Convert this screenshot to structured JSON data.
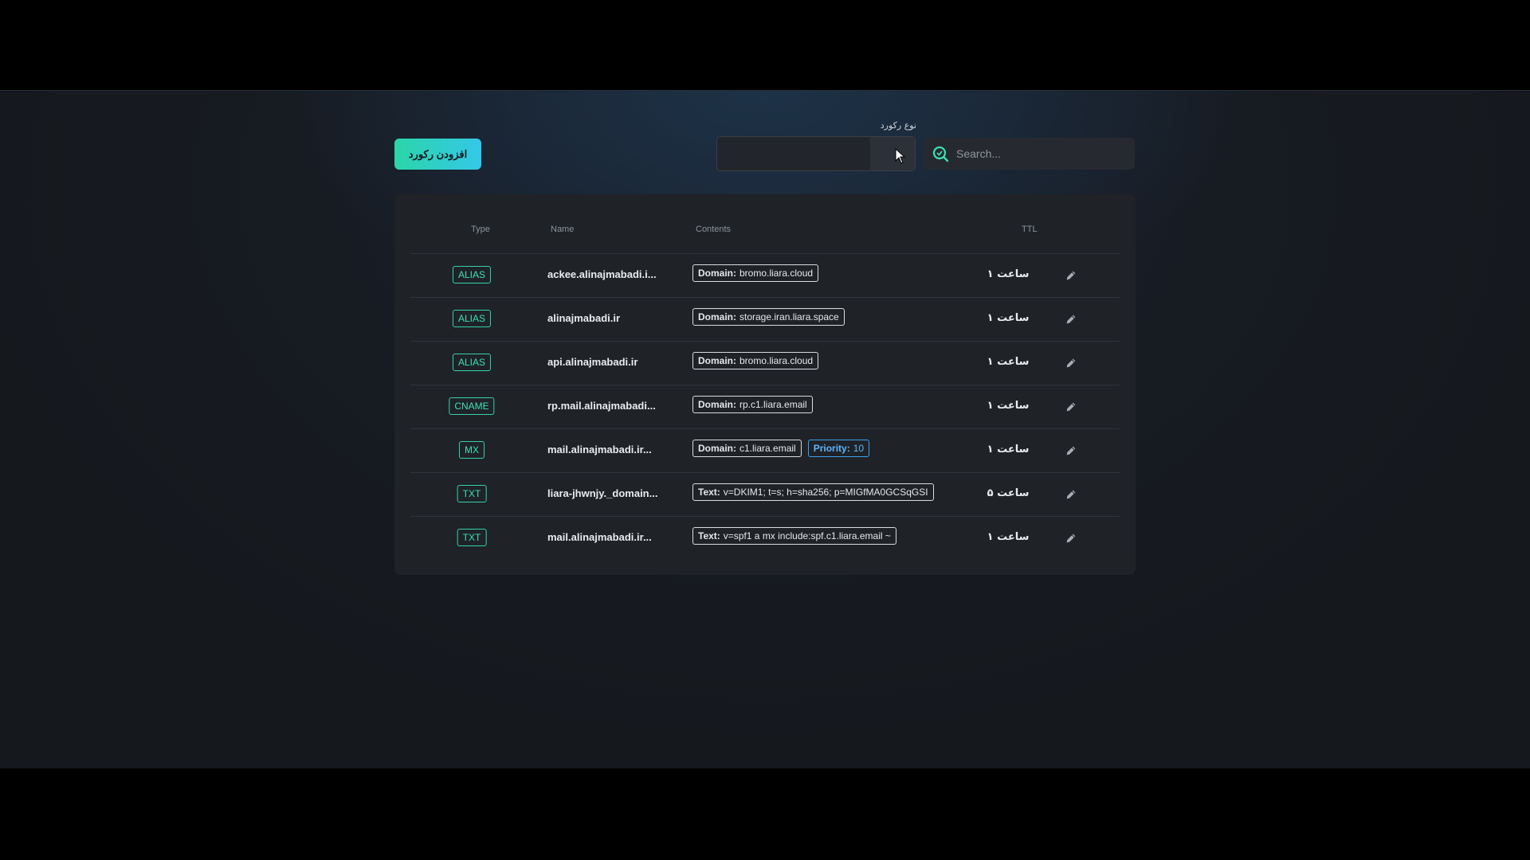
{
  "toolbar": {
    "add_button_label": "افزودن رکورد",
    "record_type_label": "نوع رکورد",
    "record_type_value": "",
    "search_placeholder": "Search..."
  },
  "table": {
    "columns": [
      "Type",
      "Name",
      "Contents",
      "TTL"
    ],
    "rows": [
      {
        "type": "ALIAS",
        "name": "ackee.alinajmabadi.i...",
        "contents": [
          {
            "key": "Domain:",
            "value": "bromo.liara.cloud"
          }
        ],
        "ttl": "۱ ساعت"
      },
      {
        "type": "ALIAS",
        "name": "alinajmabadi.ir",
        "contents": [
          {
            "key": "Domain:",
            "value": "storage.iran.liara.space"
          }
        ],
        "ttl": "۱ ساعت"
      },
      {
        "type": "ALIAS",
        "name": "api.alinajmabadi.ir",
        "contents": [
          {
            "key": "Domain:",
            "value": "bromo.liara.cloud"
          }
        ],
        "ttl": "۱ ساعت"
      },
      {
        "type": "CNAME",
        "name": "rp.mail.alinajmabadi...",
        "contents": [
          {
            "key": "Domain:",
            "value": "rp.c1.liara.email"
          }
        ],
        "ttl": "۱ ساعت"
      },
      {
        "type": "MX",
        "name": "mail.alinajmabadi.ir...",
        "contents": [
          {
            "key": "Domain:",
            "value": "c1.liara.email"
          },
          {
            "key": "Priority:",
            "value": "10",
            "accent": true
          }
        ],
        "ttl": "۱ ساعت"
      },
      {
        "type": "TXT",
        "name": "liara-jhwnjy._domain...",
        "contents": [
          {
            "key": "Text:",
            "value": "v=DKIM1; t=s; h=sha256; p=MIGfMA0GCSqGSI"
          }
        ],
        "ttl": "۵ ساعت"
      },
      {
        "type": "TXT",
        "name": "mail.alinajmabadi.ir...",
        "contents": [
          {
            "key": "Text:",
            "value": "v=spf1 a mx include:spf.c1.liara.email ~"
          }
        ],
        "ttl": "۱ ساعت"
      }
    ]
  },
  "icons": {
    "search": "search-icon",
    "edit": "pencil-icon",
    "telegram": "telegram-icon"
  },
  "colors": {
    "accent_green": "#34d3a6",
    "accent_blue": "#3aa3f0",
    "button_gradient_start": "#2bd5a8",
    "button_gradient_end": "#34c8e8"
  }
}
